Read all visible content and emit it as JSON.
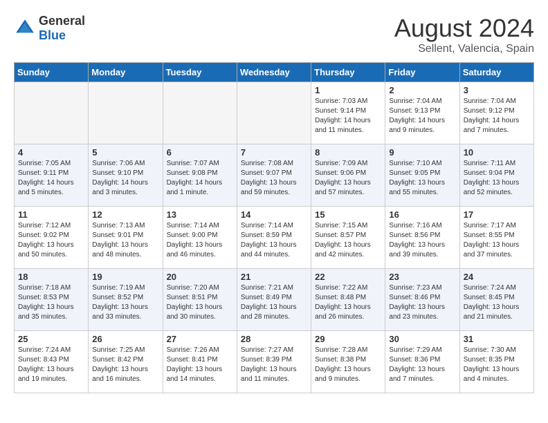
{
  "logo": {
    "text_general": "General",
    "text_blue": "Blue"
  },
  "title": "August 2024",
  "subtitle": "Sellent, Valencia, Spain",
  "days_of_week": [
    "Sunday",
    "Monday",
    "Tuesday",
    "Wednesday",
    "Thursday",
    "Friday",
    "Saturday"
  ],
  "weeks": [
    [
      {
        "day": "",
        "info": ""
      },
      {
        "day": "",
        "info": ""
      },
      {
        "day": "",
        "info": ""
      },
      {
        "day": "",
        "info": ""
      },
      {
        "day": "1",
        "info": "Sunrise: 7:03 AM\nSunset: 9:14 PM\nDaylight: 14 hours\nand 11 minutes."
      },
      {
        "day": "2",
        "info": "Sunrise: 7:04 AM\nSunset: 9:13 PM\nDaylight: 14 hours\nand 9 minutes."
      },
      {
        "day": "3",
        "info": "Sunrise: 7:04 AM\nSunset: 9:12 PM\nDaylight: 14 hours\nand 7 minutes."
      }
    ],
    [
      {
        "day": "4",
        "info": "Sunrise: 7:05 AM\nSunset: 9:11 PM\nDaylight: 14 hours\nand 5 minutes."
      },
      {
        "day": "5",
        "info": "Sunrise: 7:06 AM\nSunset: 9:10 PM\nDaylight: 14 hours\nand 3 minutes."
      },
      {
        "day": "6",
        "info": "Sunrise: 7:07 AM\nSunset: 9:08 PM\nDaylight: 14 hours\nand 1 minute."
      },
      {
        "day": "7",
        "info": "Sunrise: 7:08 AM\nSunset: 9:07 PM\nDaylight: 13 hours\nand 59 minutes."
      },
      {
        "day": "8",
        "info": "Sunrise: 7:09 AM\nSunset: 9:06 PM\nDaylight: 13 hours\nand 57 minutes."
      },
      {
        "day": "9",
        "info": "Sunrise: 7:10 AM\nSunset: 9:05 PM\nDaylight: 13 hours\nand 55 minutes."
      },
      {
        "day": "10",
        "info": "Sunrise: 7:11 AM\nSunset: 9:04 PM\nDaylight: 13 hours\nand 52 minutes."
      }
    ],
    [
      {
        "day": "11",
        "info": "Sunrise: 7:12 AM\nSunset: 9:02 PM\nDaylight: 13 hours\nand 50 minutes."
      },
      {
        "day": "12",
        "info": "Sunrise: 7:13 AM\nSunset: 9:01 PM\nDaylight: 13 hours\nand 48 minutes."
      },
      {
        "day": "13",
        "info": "Sunrise: 7:14 AM\nSunset: 9:00 PM\nDaylight: 13 hours\nand 46 minutes."
      },
      {
        "day": "14",
        "info": "Sunrise: 7:14 AM\nSunset: 8:59 PM\nDaylight: 13 hours\nand 44 minutes."
      },
      {
        "day": "15",
        "info": "Sunrise: 7:15 AM\nSunset: 8:57 PM\nDaylight: 13 hours\nand 42 minutes."
      },
      {
        "day": "16",
        "info": "Sunrise: 7:16 AM\nSunset: 8:56 PM\nDaylight: 13 hours\nand 39 minutes."
      },
      {
        "day": "17",
        "info": "Sunrise: 7:17 AM\nSunset: 8:55 PM\nDaylight: 13 hours\nand 37 minutes."
      }
    ],
    [
      {
        "day": "18",
        "info": "Sunrise: 7:18 AM\nSunset: 8:53 PM\nDaylight: 13 hours\nand 35 minutes."
      },
      {
        "day": "19",
        "info": "Sunrise: 7:19 AM\nSunset: 8:52 PM\nDaylight: 13 hours\nand 33 minutes."
      },
      {
        "day": "20",
        "info": "Sunrise: 7:20 AM\nSunset: 8:51 PM\nDaylight: 13 hours\nand 30 minutes."
      },
      {
        "day": "21",
        "info": "Sunrise: 7:21 AM\nSunset: 8:49 PM\nDaylight: 13 hours\nand 28 minutes."
      },
      {
        "day": "22",
        "info": "Sunrise: 7:22 AM\nSunset: 8:48 PM\nDaylight: 13 hours\nand 26 minutes."
      },
      {
        "day": "23",
        "info": "Sunrise: 7:23 AM\nSunset: 8:46 PM\nDaylight: 13 hours\nand 23 minutes."
      },
      {
        "day": "24",
        "info": "Sunrise: 7:24 AM\nSunset: 8:45 PM\nDaylight: 13 hours\nand 21 minutes."
      }
    ],
    [
      {
        "day": "25",
        "info": "Sunrise: 7:24 AM\nSunset: 8:43 PM\nDaylight: 13 hours\nand 19 minutes."
      },
      {
        "day": "26",
        "info": "Sunrise: 7:25 AM\nSunset: 8:42 PM\nDaylight: 13 hours\nand 16 minutes."
      },
      {
        "day": "27",
        "info": "Sunrise: 7:26 AM\nSunset: 8:41 PM\nDaylight: 13 hours\nand 14 minutes."
      },
      {
        "day": "28",
        "info": "Sunrise: 7:27 AM\nSunset: 8:39 PM\nDaylight: 13 hours\nand 11 minutes."
      },
      {
        "day": "29",
        "info": "Sunrise: 7:28 AM\nSunset: 8:38 PM\nDaylight: 13 hours\nand 9 minutes."
      },
      {
        "day": "30",
        "info": "Sunrise: 7:29 AM\nSunset: 8:36 PM\nDaylight: 13 hours\nand 7 minutes."
      },
      {
        "day": "31",
        "info": "Sunrise: 7:30 AM\nSunset: 8:35 PM\nDaylight: 13 hours\nand 4 minutes."
      }
    ]
  ]
}
